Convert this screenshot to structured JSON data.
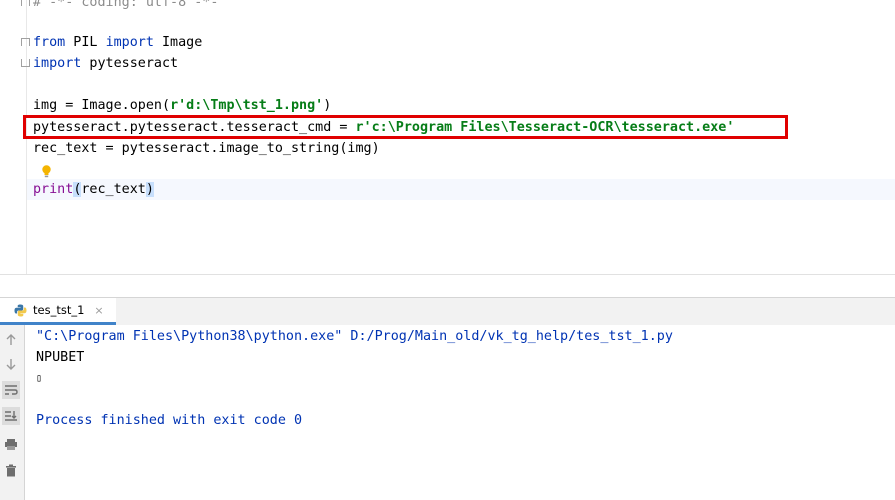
{
  "editor": {
    "lines": {
      "l0": "# -*- coding: utf-8 -*-",
      "l2_kw1": "from",
      "l2_mod": " PIL ",
      "l2_kw2": "import",
      "l2_name": " Image",
      "l3_kw": "import",
      "l3_name": " pytesseract",
      "l5_code": "img = Image.open(",
      "l5_str": "r'd:\\Tmp\\tst_1.png'",
      "l5_end": ")",
      "l6_code": "pytesseract.pytesseract.tesseract_cmd = ",
      "l6_str": "r'c:\\Program Files\\Tesseract-OCR\\tesseract.exe'",
      "l7_code": "rec_text = pytesseract.image_to_string(img)",
      "l9_bi": "print",
      "l9_open": "(",
      "l9_arg": "rec_text",
      "l9_close": ")"
    }
  },
  "run_panel": {
    "tab_label": "tes_tst_1",
    "tab_close": "×",
    "console": {
      "command": "\"C:\\Program Files\\Python38\\python.exe\" D:/Prog/Main_old/vk_tg_help/tes_tst_1.py",
      "output1": "NPUBET",
      "output2": "▯",
      "finished": "Process finished with exit code 0"
    }
  },
  "colors": {
    "highlight_box": "#e00000",
    "keyword": "#0033b3",
    "string": "#067d17",
    "builtin": "#871094"
  },
  "icons": {
    "up": "arrow-up-icon",
    "down": "arrow-down-icon",
    "wrap": "soft-wrap-icon",
    "scroll": "scroll-to-end-icon",
    "print": "print-icon",
    "trash": "trash-icon"
  }
}
